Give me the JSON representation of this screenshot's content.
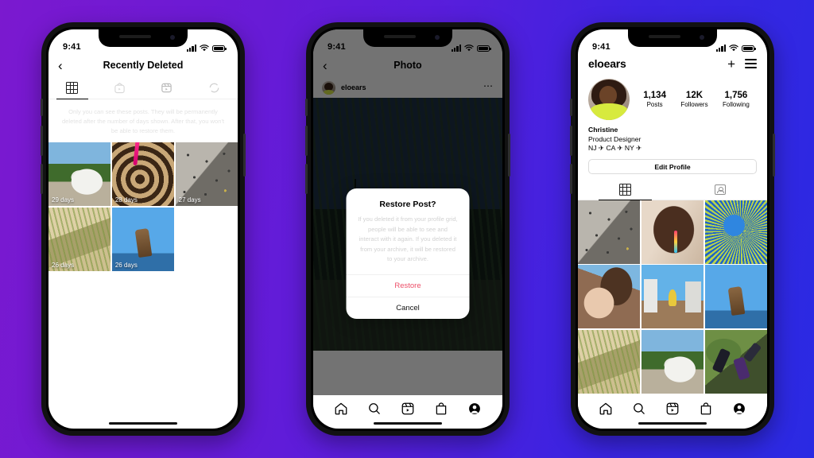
{
  "background": {
    "gradient_from": "#7b19cf",
    "gradient_to": "#2a2ae3"
  },
  "status_bar": {
    "time": "9:41"
  },
  "phone1": {
    "nav": {
      "back_icon": "chevron-left-icon",
      "title": "Recently Deleted"
    },
    "tabs": [
      {
        "name": "grid",
        "icon": "grid-icon",
        "active": true
      },
      {
        "name": "igtv",
        "icon": "igtv-icon",
        "active": false
      },
      {
        "name": "reels",
        "icon": "reels-icon",
        "active": false
      },
      {
        "name": "stories",
        "icon": "circle-dashed-icon",
        "active": false
      }
    ],
    "info_text": "Only you can see these posts. They will be permanently deleted after the number of days shown. After that, you won't be able to restore them.",
    "posts": [
      {
        "days": "29 days",
        "art": "a-dog"
      },
      {
        "days": "28 days",
        "art": "a-spiral"
      },
      {
        "days": "27 days",
        "art": "a-rocks"
      },
      {
        "days": "26 days",
        "art": "a-grass"
      },
      {
        "days": "26 days",
        "art": "a-boot"
      }
    ]
  },
  "phone2": {
    "nav": {
      "back_icon": "chevron-left-icon",
      "title": "Photo"
    },
    "post": {
      "username": "eloears",
      "menu_icon": "more-options-icon"
    },
    "dialog": {
      "title": "Restore Post?",
      "message": "If you deleted it from your profile grid, people will be able to see and interact with it again. If you deleted it from your archive, it will be restored to your archive.",
      "restore_label": "Restore",
      "cancel_label": "Cancel",
      "restore_color": "#ed4f68"
    }
  },
  "phone3": {
    "header": {
      "username": "eloears",
      "add_icon": "plus-icon",
      "menu_icon": "hamburger-icon"
    },
    "stats": [
      {
        "number": "1,134",
        "label": "Posts"
      },
      {
        "number": "12K",
        "label": "Followers"
      },
      {
        "number": "1,756",
        "label": "Following"
      }
    ],
    "bio": {
      "name": "Christine",
      "title": "Product Designer",
      "locations": "NJ ✈ CA ✈ NY ✈"
    },
    "edit_profile_label": "Edit Profile",
    "tabs": [
      {
        "name": "grid",
        "icon": "grid-icon",
        "active": true
      },
      {
        "name": "tagged",
        "icon": "tagged-person-icon",
        "active": false
      }
    ],
    "grid": [
      {
        "art": "a-rocks"
      },
      {
        "art": "a-portrait"
      },
      {
        "art": "a-mural"
      },
      {
        "art": "a-two"
      },
      {
        "art": "a-temple"
      },
      {
        "art": "a-boot"
      },
      {
        "art": "a-grass"
      },
      {
        "art": "a-dog"
      },
      {
        "art": "a-jump"
      }
    ]
  },
  "bottom_nav": [
    {
      "name": "home",
      "icon": "home-icon"
    },
    {
      "name": "search",
      "icon": "search-icon"
    },
    {
      "name": "reels",
      "icon": "reels-icon"
    },
    {
      "name": "shop",
      "icon": "shop-bag-icon"
    },
    {
      "name": "profile",
      "icon": "profile-avatar-icon"
    }
  ]
}
